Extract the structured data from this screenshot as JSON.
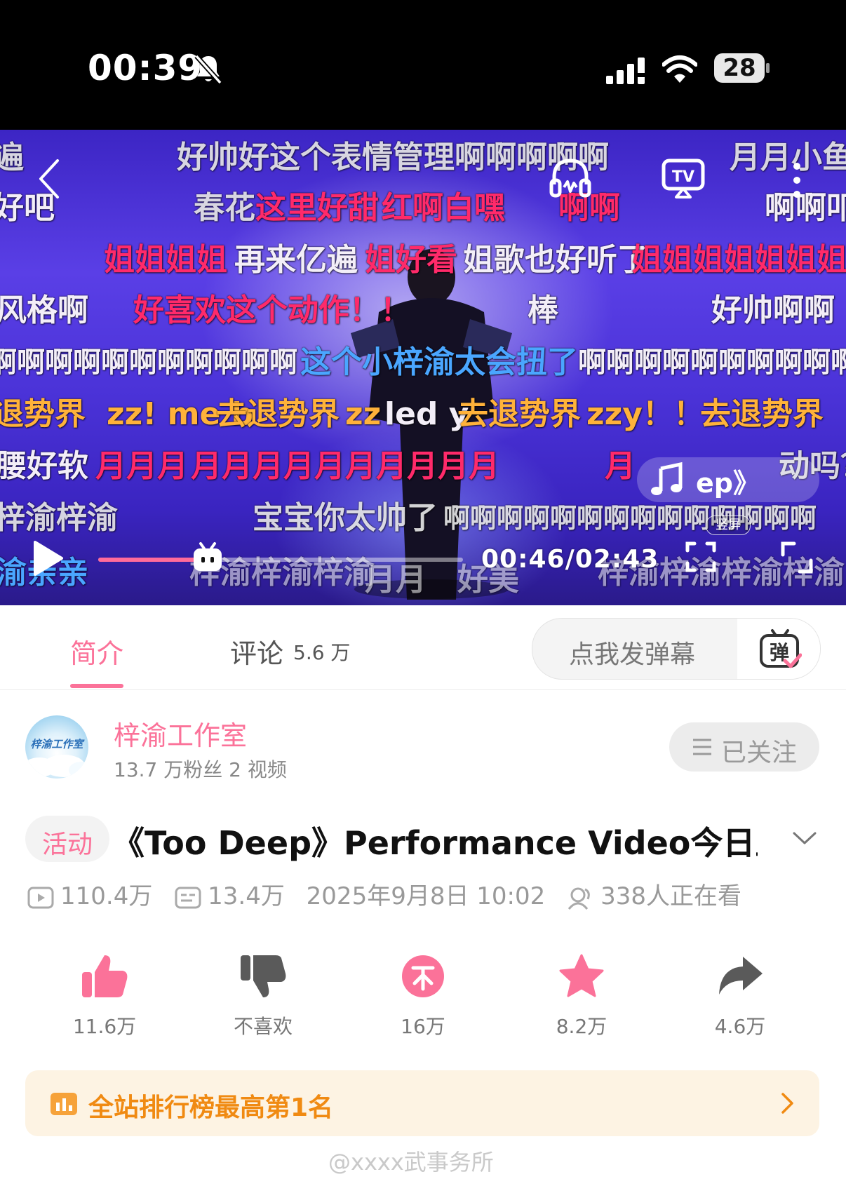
{
  "status_bar": {
    "time": "00:39",
    "battery": "28",
    "icons": [
      "bell-slash-icon",
      "signal-icon",
      "wifi-icon",
      "battery-icon"
    ]
  },
  "player": {
    "danmaku": [
      "遍",
      "好帅好",
      "这个表情管理啊啊啊啊啊",
      "月月小鱼",
      "好吧",
      "春花",
      "这里好甜",
      "红啊白嘿",
      "啊啊",
      "啊啊叩",
      "姐姐姐姐",
      "再来亿遍",
      "姐好看",
      "姐歌也好听了",
      "姐姐姐姐姐姐姐",
      "风格啊",
      "好喜欢这个动作！！",
      "棒",
      "好帅啊啊",
      "啊啊啊啊啊啊啊啊啊啊啊",
      "这个小梓渝太会扭了",
      "啊啊啊啊啊啊啊啊啊啊",
      "退势界",
      "zz! me b",
      "去退势界",
      "zz",
      "led y",
      "去退势界",
      "zzy！！",
      "去退势界",
      "腰好软",
      "月月月",
      "月月月月月月月月月月",
      "月",
      "动吗？",
      "梓渝梓渝",
      "宝宝你太帅了",
      "啊啊啊啊啊啊啊啊啊啊啊啊啊啊",
      "渝亲亲",
      "梓渝梓渝梓渝",
      "月月",
      "好美",
      "梓渝梓渝梓渝梓渝"
    ],
    "music_label": "ep》",
    "vertical_label": "竖屏",
    "time_current": "00:46",
    "time_total": "02:43",
    "time_display": "00:46/02:43",
    "progress": 0.282
  },
  "tabs": {
    "intro_label": "简介",
    "comments_label": "评论",
    "comments_count": "5.6 万",
    "danmaku_placeholder": "点我发弹幕",
    "danmaku_send_label": "弹"
  },
  "uploader": {
    "avatar_text": "梓渝工作室",
    "name": "梓渝工作室",
    "stats": "13.7 万粉丝   2 视频",
    "follow_label": "已关注"
  },
  "video": {
    "tag": "活动",
    "title": "《Too Deep》Performance Video今日上…",
    "views": "110.4万",
    "danmaku_count": "13.4万",
    "date": "2025年9月8日 10:02",
    "watching": "338人正在看"
  },
  "actions": [
    {
      "label": "11.6万",
      "icon": "thumb-up-icon"
    },
    {
      "label": "不喜欢",
      "icon": "thumb-down-icon"
    },
    {
      "label": "16万",
      "icon": "coin-icon"
    },
    {
      "label": "8.2万",
      "icon": "star-icon"
    },
    {
      "label": "4.6万",
      "icon": "share-icon"
    }
  ],
  "ranking": {
    "label": "全站排行榜最高第1名"
  },
  "watermark": "@xxxx武事务所",
  "colors": {
    "accent": "#fb7299",
    "ranking": "#f08a12",
    "video_bg": "#4b33d8"
  }
}
